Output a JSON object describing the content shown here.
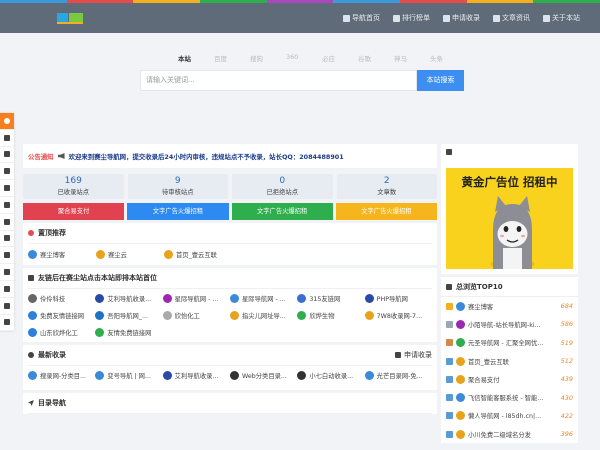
{
  "colors": {
    "stripe": [
      "#3b9ad9",
      "#e54b4b",
      "#f2b01e",
      "#2eae4c",
      "#ab47bc",
      "#3b9ad9",
      "#e54b4b",
      "#f2b01e",
      "#2eae4c"
    ],
    "header_bg": "#5f6b78",
    "accent": "#3c8ff0",
    "notice_label": "#e54b4b",
    "count": "#e88b25"
  },
  "header": {
    "nav": [
      {
        "label": "导航首页",
        "icon": "home-icon"
      },
      {
        "label": "排行榜单",
        "icon": "ranking-icon"
      },
      {
        "label": "申请收录",
        "icon": "plus-square-icon"
      },
      {
        "label": "文章资讯",
        "icon": "article-icon"
      },
      {
        "label": "关于本站",
        "icon": "info-icon"
      }
    ]
  },
  "search": {
    "tabs": [
      "本站",
      "百度",
      "搜狗",
      "360",
      "必应",
      "谷歌",
      "神马",
      "头条"
    ],
    "placeholder": "请输入关键词...",
    "button": "本站搜索"
  },
  "leftbar": [
    "fire-icon",
    "send-icon",
    "document-icon",
    "globe-icon",
    "video-icon",
    "cloud-icon",
    "chart-icon",
    "graduation-icon",
    "yen-icon",
    "wrench-icon",
    "keyboard-icon",
    "monitor-icon",
    "download-icon"
  ],
  "notice": {
    "label": "公告通知",
    "icon": "megaphone-icon",
    "text": "欢迎来到赛尘导航网，提交收录后24小时内审核，违规站点不予收录，站长QQ：2084488901"
  },
  "stats": [
    {
      "value": "169",
      "label": "已收录站点"
    },
    {
      "value": "9",
      "label": "待审核站点"
    },
    {
      "value": "0",
      "label": "已拒绝站点"
    },
    {
      "value": "2",
      "label": "文章数"
    }
  ],
  "ads": [
    {
      "label": "聚合易支付",
      "color": "#e0424f"
    },
    {
      "label": "文字广告火爆招租",
      "color": "#2d8af0"
    },
    {
      "label": "文字广告火爆招租",
      "color": "#2eae4c"
    },
    {
      "label": "文字广告火爆招租",
      "color": "#f6b51c"
    }
  ],
  "top_recommend": {
    "title": "置顶推荐",
    "icon": "fire-icon",
    "items": [
      {
        "name": "赛尘博客",
        "color": "#3b8ad9"
      },
      {
        "name": "赛尘云",
        "color": "#e7a31b"
      },
      {
        "name": "首页_壹云互联",
        "color": "#e7a31b"
      }
    ]
  },
  "friend_links": {
    "title": "友链后在赛尘站点击本站即排本站首位",
    "icon": "link-icon",
    "items": [
      {
        "name": "伶伶科技",
        "color": "#666666"
      },
      {
        "name": "艾利导航收录...",
        "color": "#2b4aa8"
      },
      {
        "name": "星际导航网 - ...",
        "color": "#9c27b0"
      },
      {
        "name": "星际导航网 - ...",
        "color": "#3b8ad9"
      },
      {
        "name": "315友链网",
        "color": "#3b6dd9"
      },
      {
        "name": "PHP导航网",
        "color": "#2b4aa8"
      },
      {
        "name": "免费友情链接网",
        "color": "#2e7fd9"
      },
      {
        "name": "吾阳导航网_...",
        "color": "#1e73c8"
      },
      {
        "name": "欣怡化工",
        "color": "#aaaaaa"
      },
      {
        "name": "指尖儿网址导...",
        "color": "#e7a31b"
      },
      {
        "name": "欣烨生物",
        "color": "#2eae4c"
      },
      {
        "name": "7W8收录网-7...",
        "color": "#e7a31b"
      },
      {
        "name": "山东欣烨化工",
        "color": "#2e7fd9"
      },
      {
        "name": "友情免费链接网",
        "color": "#2eae4c"
      }
    ]
  },
  "latest": {
    "title": "最新收录",
    "icon": "clock-icon",
    "apply": "申请收录",
    "apply_icon": "plus-square-icon",
    "items": [
      {
        "name": "搜录网-分类目...",
        "color": "#3b8ad9"
      },
      {
        "name": "变号导航 | 网...",
        "color": "#3b8ad9"
      },
      {
        "name": "艾利导航收录...",
        "color": "#2b4aa8"
      },
      {
        "name": "Web分类目录...",
        "color": "#333333"
      },
      {
        "name": "小七白动收录...",
        "color": "#333333"
      },
      {
        "name": "光芒目录网-免...",
        "color": "#3b8ad9"
      }
    ]
  },
  "directory": {
    "title": "目录导航",
    "icon": "send-icon"
  },
  "sidebar": {
    "ad_title": "黄金广告位 招租中",
    "browse_title": "总浏览TOP10",
    "browse_icon": "chart-icon",
    "top10": [
      {
        "rank_icon": "trophy-icon",
        "name": "赛尘博客",
        "count": "684",
        "color": "#3b8ad9"
      },
      {
        "rank_icon": "trophy-icon",
        "name": "小陌导航-站长导航网-ki...",
        "count": "586",
        "color": "#9c27b0"
      },
      {
        "rank_icon": "trophy-icon",
        "name": "元圣导航网 - 汇聚全网优...",
        "count": "519",
        "color": "#2eae4c"
      },
      {
        "rank_icon": "rank-icon",
        "name": "首页_壹云互联",
        "count": "512",
        "color": "#e7a31b"
      },
      {
        "rank_icon": "rank-icon",
        "name": "聚合易支付",
        "count": "439",
        "color": "#e7a31b"
      },
      {
        "rank_icon": "rank-icon",
        "name": "飞信智能客服系统 - 智能...",
        "count": "430",
        "color": "#3b8ad9"
      },
      {
        "rank_icon": "rank-icon",
        "name": "懒人导航网 - l85dh.cn|...",
        "count": "422",
        "color": "#e7a31b"
      },
      {
        "rank_icon": "rank-icon",
        "name": "小川免费二级域名分发",
        "count": "396",
        "color": "#e7a31b"
      }
    ]
  }
}
